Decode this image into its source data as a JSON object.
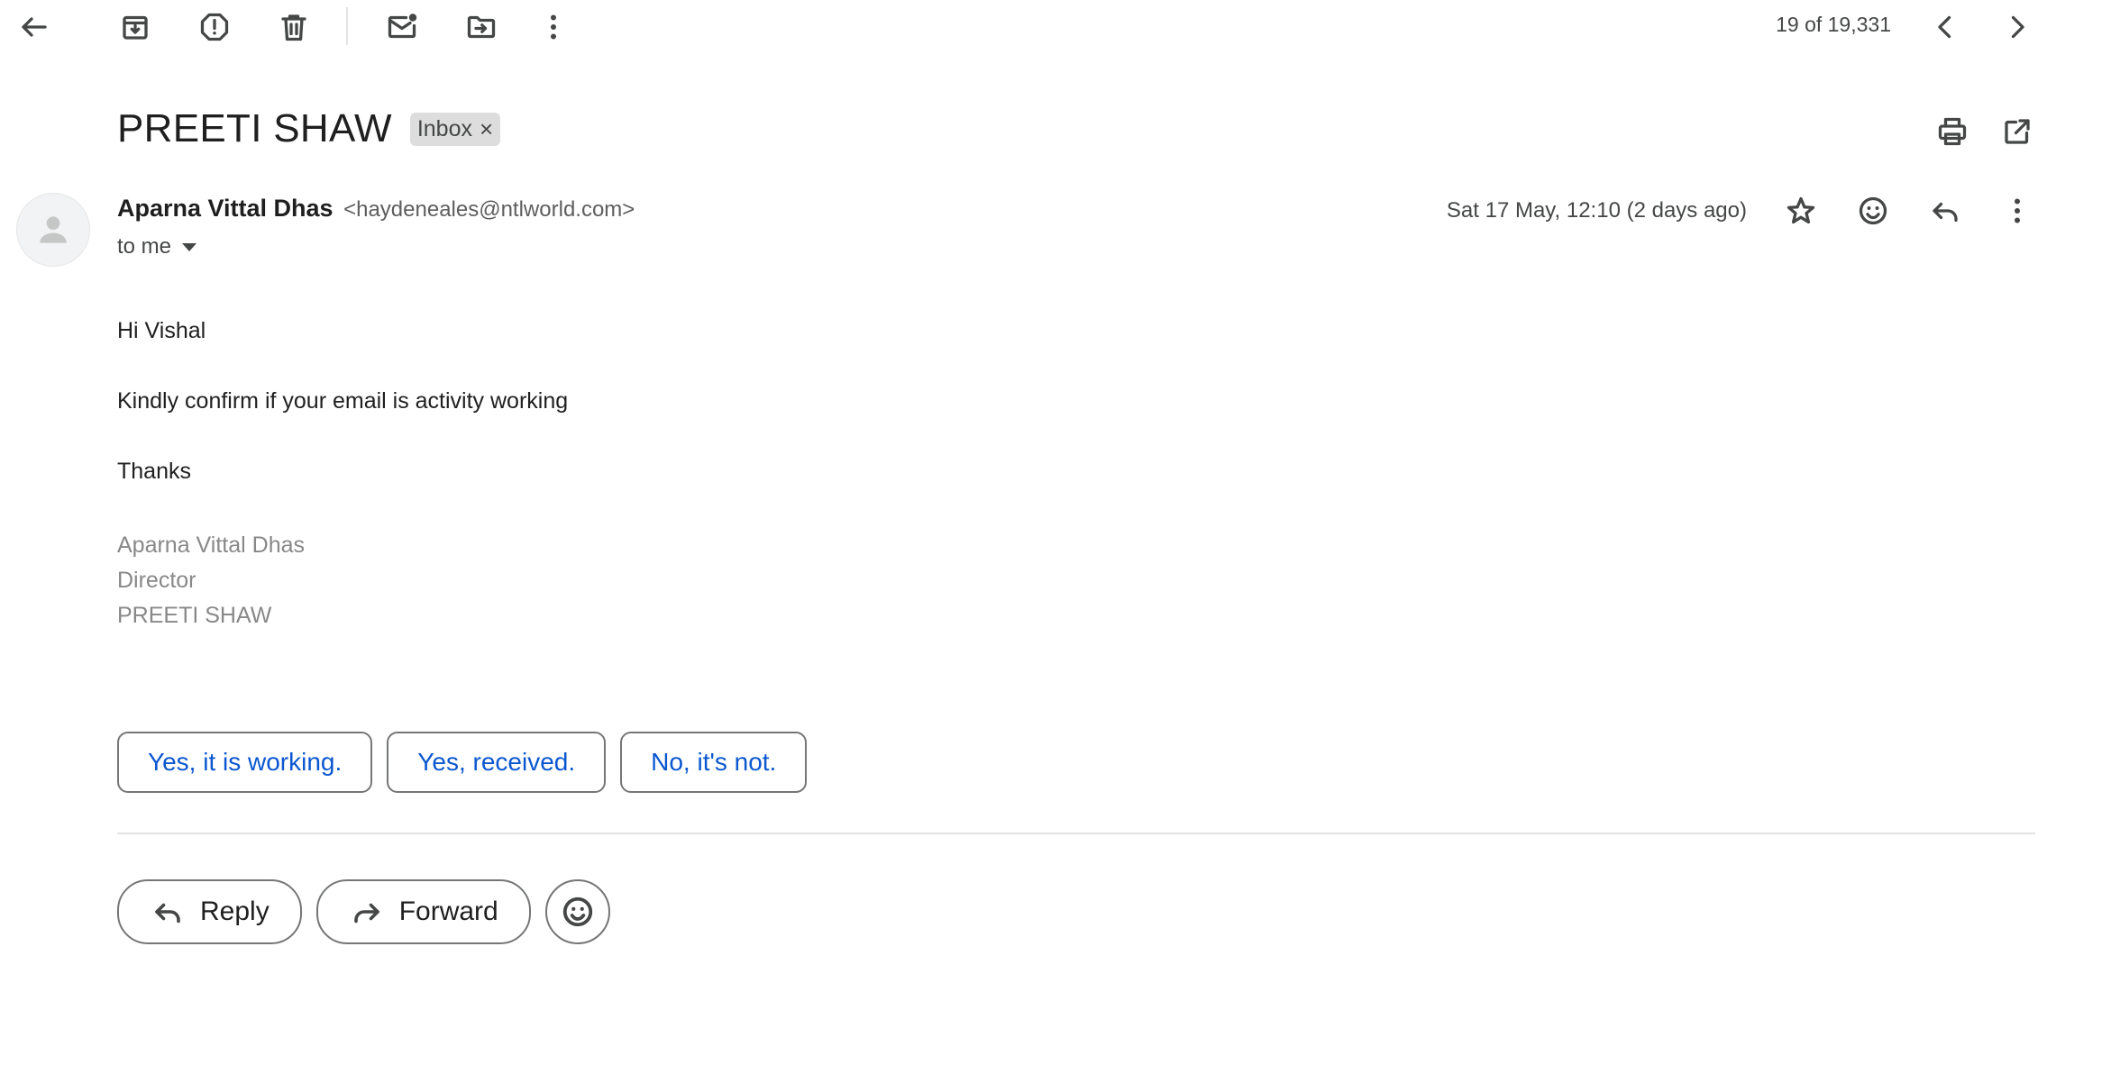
{
  "toolbar": {
    "icons": [
      "back-arrow-icon",
      "archive-icon",
      "report-spam-icon",
      "delete-icon",
      "mark-unread-icon",
      "move-to-icon",
      "more-vert-icon"
    ],
    "pager": "19 of 19,331"
  },
  "thread": {
    "subject": "PREETI SHAW",
    "label": "Inbox",
    "label_remove": "×"
  },
  "message": {
    "sender_name": "Aparna Vittal Dhas",
    "sender_email": "<haydeneales@ntlworld.com>",
    "recipient": "to me",
    "date": "Sat 17 May, 12:10 (2 days ago)",
    "body": {
      "greeting": "Hi Vishal",
      "line1": "Kindly confirm if your email is activity working",
      "closing": "Thanks",
      "signature": [
        "Aparna Vittal Dhas",
        "Director",
        "PREETI SHAW"
      ]
    }
  },
  "smart_replies": [
    "Yes, it is working.",
    "Yes, received.",
    "No, it's not."
  ],
  "actions": {
    "reply": "Reply",
    "forward": "Forward"
  },
  "colors": {
    "accent": "#0b57d0",
    "icon": "#444746",
    "signature": "#888888",
    "chip_bg": "#dddddd"
  }
}
